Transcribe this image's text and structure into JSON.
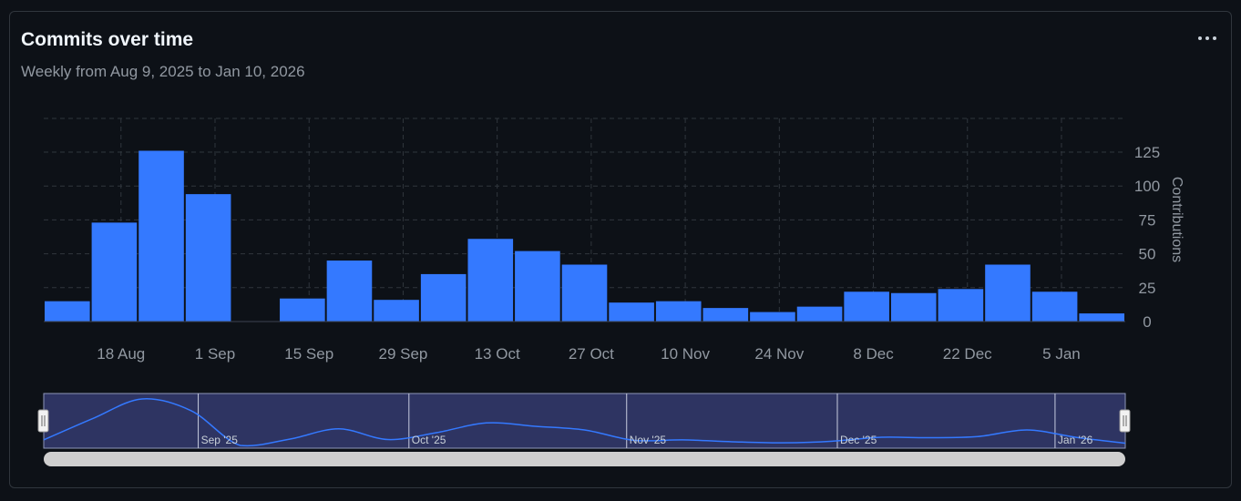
{
  "card": {
    "title": "Commits over time",
    "subtitle": "Weekly from Aug 9, 2025 to Jan 10, 2026",
    "menu_icon": "kebab-horizontal-icon"
  },
  "colors": {
    "background": "#0d1117",
    "bar": "#3479ff",
    "grid": "#30363d",
    "navigator_fill": "#2e3462",
    "scrollbar": "#cfcfcf",
    "text_muted": "#9198a1"
  },
  "chart_data": {
    "type": "bar",
    "ylabel": "Contributions",
    "ylim": [
      0,
      125
    ],
    "yticks": [
      0,
      25,
      50,
      75,
      100,
      125
    ],
    "x": [
      "2025-08-10",
      "2025-08-17",
      "2025-08-24",
      "2025-08-31",
      "2025-09-07",
      "2025-09-14",
      "2025-09-21",
      "2025-09-28",
      "2025-10-05",
      "2025-10-12",
      "2025-10-19",
      "2025-10-26",
      "2025-11-02",
      "2025-11-09",
      "2025-11-16",
      "2025-11-23",
      "2025-11-30",
      "2025-12-07",
      "2025-12-14",
      "2025-12-21",
      "2025-12-28",
      "2026-01-04",
      "2026-01-11"
    ],
    "values": [
      15,
      73,
      126,
      94,
      0,
      17,
      45,
      16,
      35,
      61,
      52,
      42,
      14,
      15,
      10,
      7,
      11,
      22,
      21,
      24,
      42,
      22,
      6
    ],
    "xticks": [
      {
        "date": "2025-08-18",
        "label": "18 Aug"
      },
      {
        "date": "2025-09-01",
        "label": "1 Sep"
      },
      {
        "date": "2025-09-15",
        "label": "15 Sep"
      },
      {
        "date": "2025-09-29",
        "label": "29 Sep"
      },
      {
        "date": "2025-10-13",
        "label": "13 Oct"
      },
      {
        "date": "2025-10-27",
        "label": "27 Oct"
      },
      {
        "date": "2025-11-10",
        "label": "10 Nov"
      },
      {
        "date": "2025-11-24",
        "label": "24 Nov"
      },
      {
        "date": "2025-12-08",
        "label": "8 Dec"
      },
      {
        "date": "2025-12-22",
        "label": "22 Dec"
      },
      {
        "date": "2026-01-05",
        "label": "5 Jan"
      }
    ],
    "grid": true,
    "navigator": {
      "labels": [
        {
          "date": "2025-09-01",
          "label": "Sep '25"
        },
        {
          "date": "2025-10-01",
          "label": "Oct '25"
        },
        {
          "date": "2025-11-01",
          "label": "Nov '25"
        },
        {
          "date": "2025-12-01",
          "label": "Dec '25"
        },
        {
          "date": "2026-01-01",
          "label": "Jan '26"
        }
      ],
      "selection": "full range"
    }
  }
}
